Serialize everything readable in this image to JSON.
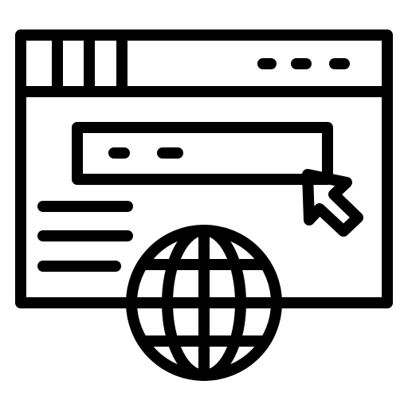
{
  "icon": {
    "name": "web-browser-globe-icon",
    "stroke_color": "#000000",
    "background_color": "#ffffff",
    "parts": [
      "browser-window-icon",
      "title-bar-tabs",
      "window-control-dots",
      "address-bar",
      "mouse-cursor-icon",
      "text-lines",
      "globe-icon"
    ]
  }
}
